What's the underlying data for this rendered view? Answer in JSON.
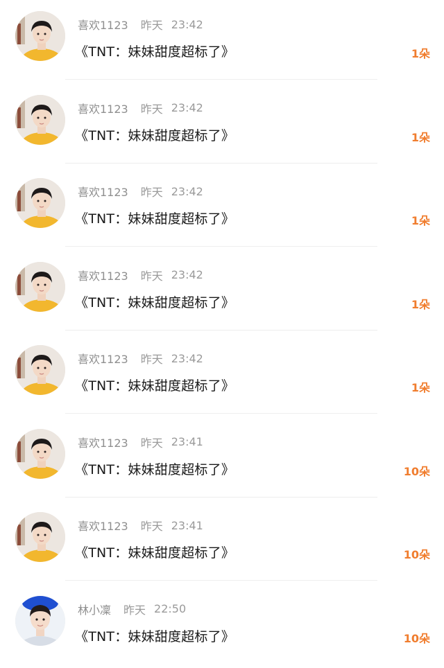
{
  "comments": [
    {
      "user": "喜欢1123",
      "day": "昨天",
      "time": "23:42",
      "title": "《TNT：妹妹甜度超标了》",
      "gift": "1朵",
      "avatar_icon": "boy-yellow-shirt-avatar"
    },
    {
      "user": "喜欢1123",
      "day": "昨天",
      "time": "23:42",
      "title": "《TNT：妹妹甜度超标了》",
      "gift": "1朵",
      "avatar_icon": "boy-yellow-shirt-avatar"
    },
    {
      "user": "喜欢1123",
      "day": "昨天",
      "time": "23:42",
      "title": "《TNT：妹妹甜度超标了》",
      "gift": "1朵",
      "avatar_icon": "boy-yellow-shirt-avatar"
    },
    {
      "user": "喜欢1123",
      "day": "昨天",
      "time": "23:42",
      "title": "《TNT：妹妹甜度超标了》",
      "gift": "1朵",
      "avatar_icon": "boy-yellow-shirt-avatar"
    },
    {
      "user": "喜欢1123",
      "day": "昨天",
      "time": "23:42",
      "title": "《TNT：妹妹甜度超标了》",
      "gift": "1朵",
      "avatar_icon": "boy-yellow-shirt-avatar"
    },
    {
      "user": "喜欢1123",
      "day": "昨天",
      "time": "23:41",
      "title": "《TNT：妹妹甜度超标了》",
      "gift": "10朵",
      "avatar_icon": "boy-yellow-shirt-avatar"
    },
    {
      "user": "喜欢1123",
      "day": "昨天",
      "time": "23:41",
      "title": "《TNT：妹妹甜度超标了》",
      "gift": "10朵",
      "avatar_icon": "boy-yellow-shirt-avatar"
    },
    {
      "user": "林小凜",
      "day": "昨天",
      "time": "22:50",
      "title": "《TNT：妹妹甜度超标了》",
      "gift": "10朵",
      "avatar_icon": "boy-blue-background-avatar"
    }
  ],
  "colors": {
    "gift": "#f07d2e",
    "meta": "#9a9a9a",
    "title": "#1a1a1a",
    "divider": "#eeeeee"
  }
}
